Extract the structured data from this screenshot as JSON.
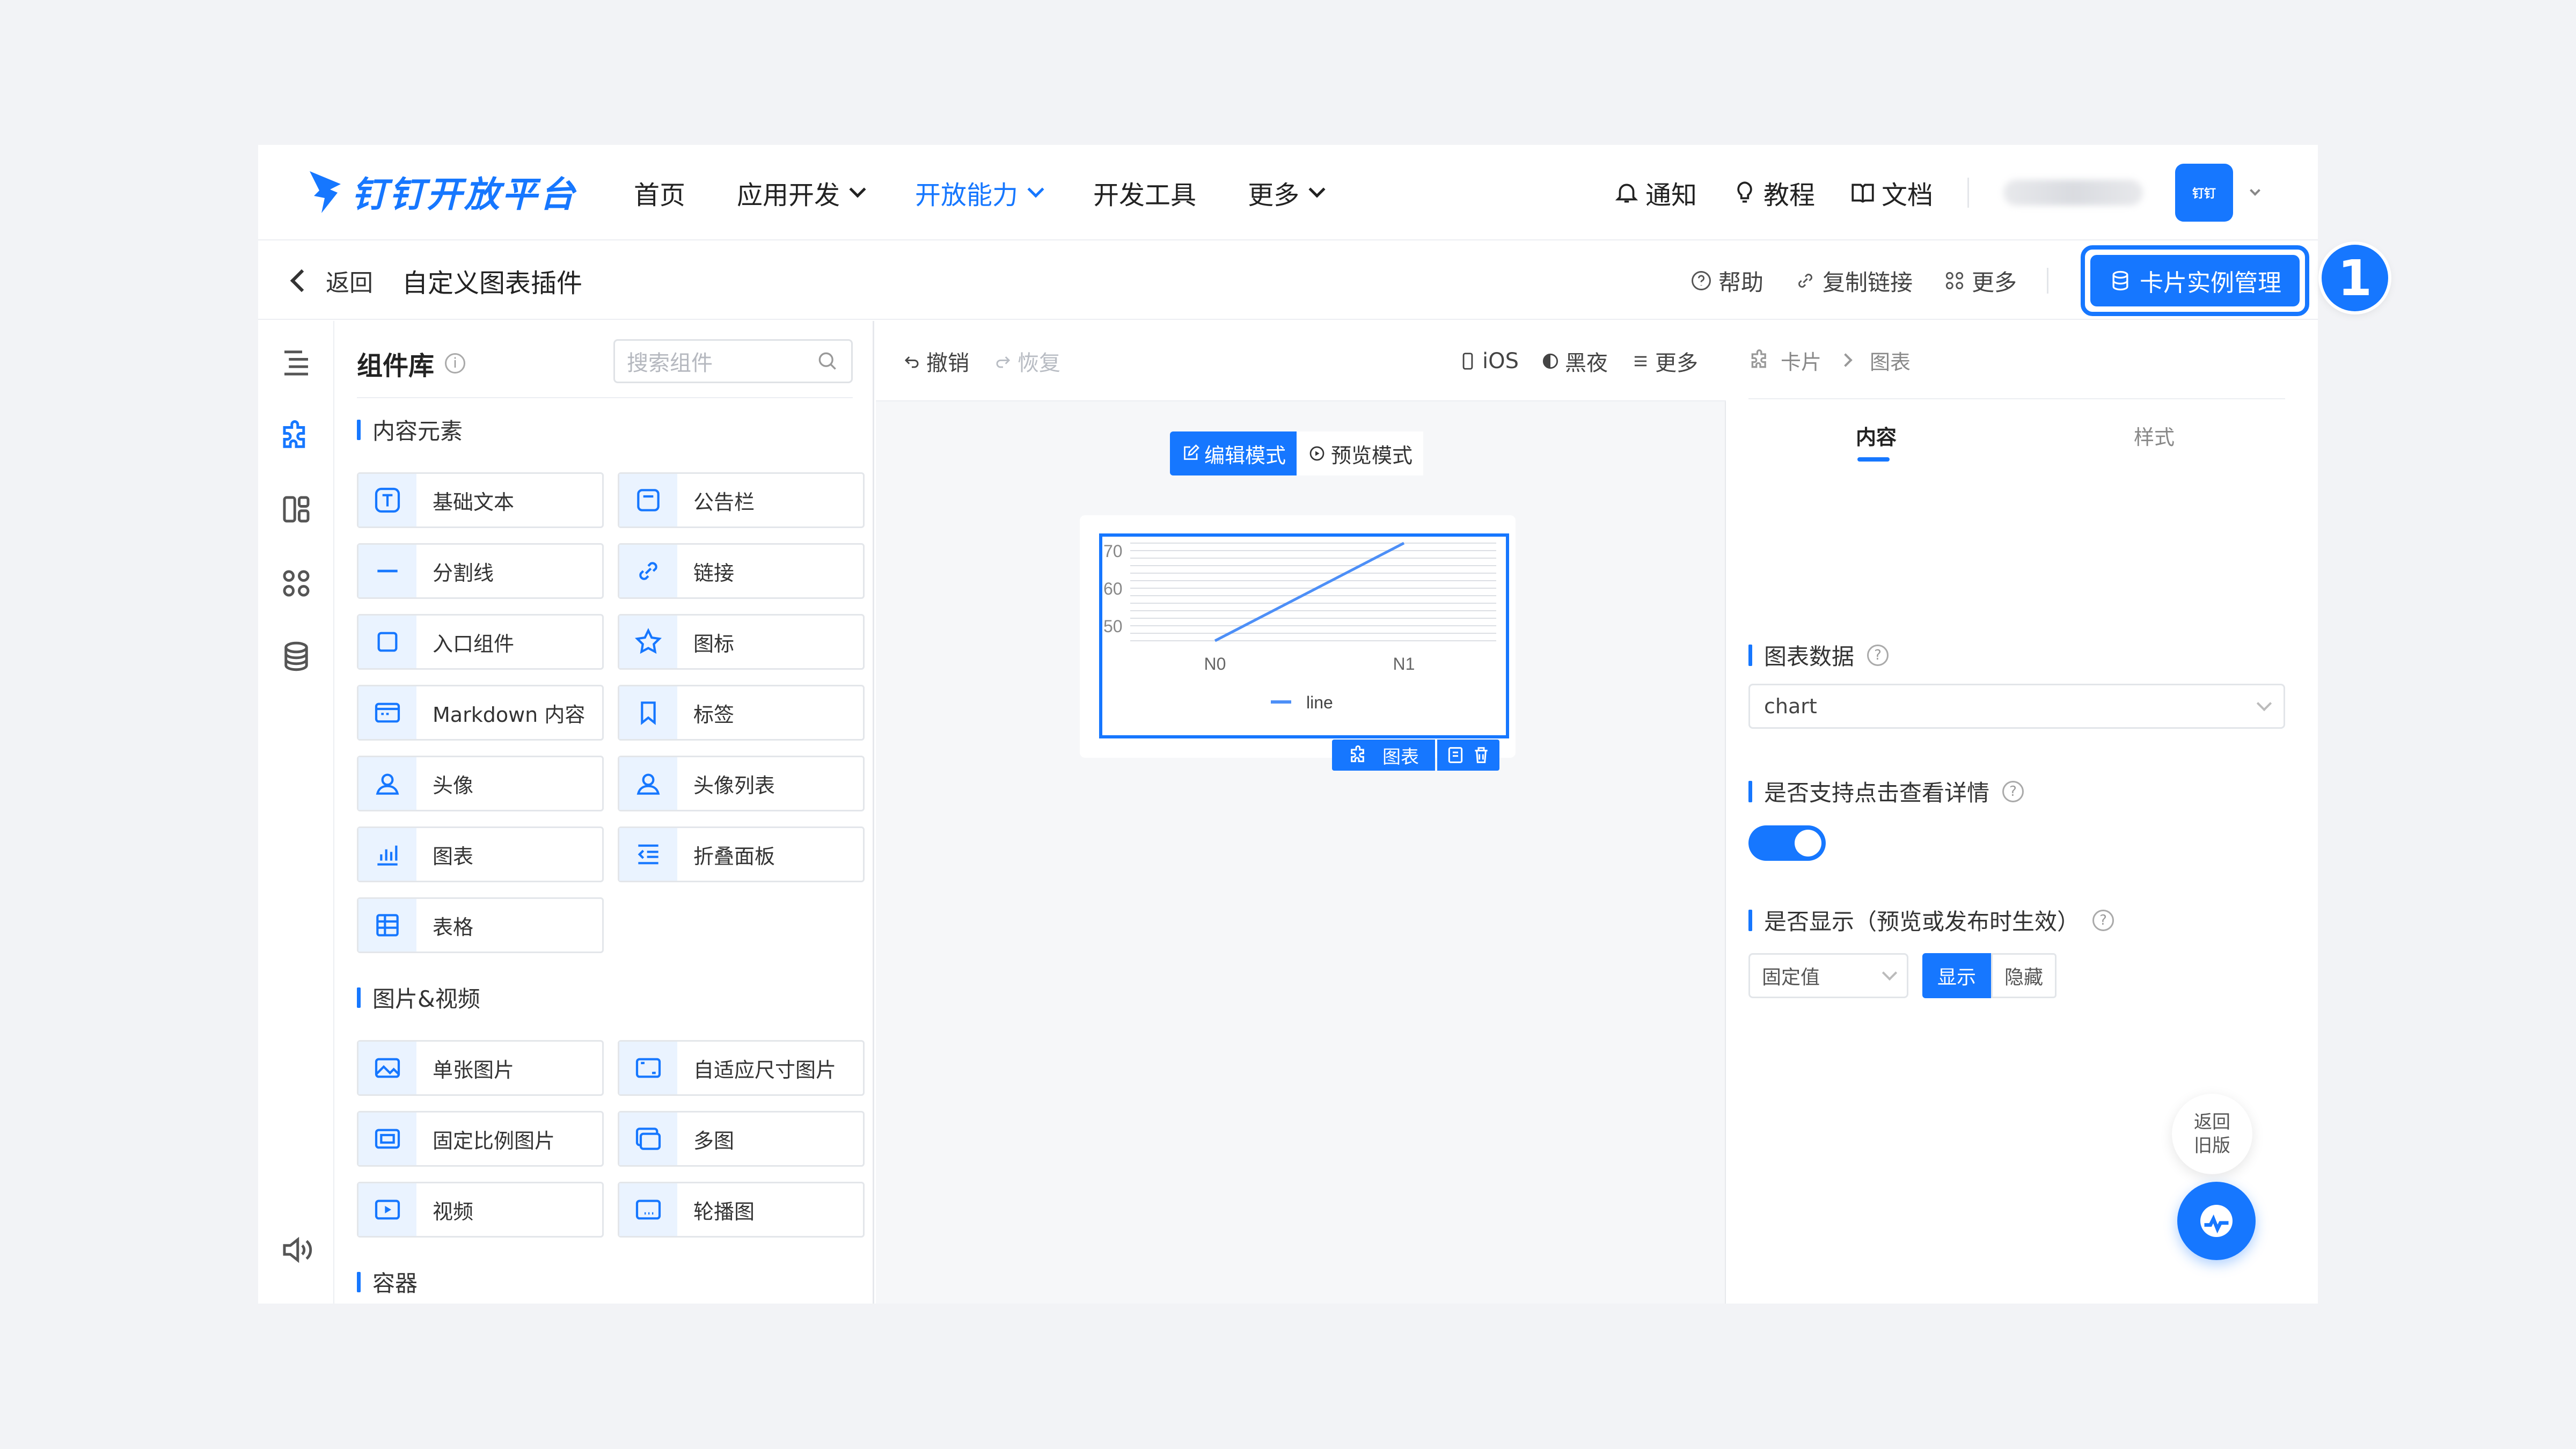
{
  "colors": {
    "accent": "#1677ff",
    "page_bg": "#f2f3f6"
  },
  "header": {
    "logo_text": "钉钉开放平台",
    "nav": [
      {
        "label": "首页"
      },
      {
        "label": "应用开发"
      },
      {
        "label": "开放能力"
      },
      {
        "label": "开发工具"
      },
      {
        "label": "更多"
      }
    ],
    "right": {
      "notify": "通知",
      "tutorial": "教程",
      "docs": "文档",
      "avatar_text": "钉钉"
    }
  },
  "subheader": {
    "back": "返回",
    "title": "自定义图表插件",
    "help": "帮助",
    "copy_link": "复制链接",
    "more": "更多",
    "card_manage": "卡片实例管理"
  },
  "library": {
    "title": "组件库",
    "search_placeholder": "搜索组件",
    "sections": {
      "content": "内容元素",
      "media": "图片&视频",
      "container": "容器"
    },
    "content_items": [
      "基础文本",
      "公告栏",
      "分割线",
      "链接",
      "入口组件",
      "图标",
      "Markdown 内容",
      "标签",
      "头像",
      "头像列表",
      "图表",
      "折叠面板",
      "表格"
    ],
    "media_items": [
      "单张图片",
      "自适应尺寸图片",
      "固定比例图片",
      "多图",
      "视频",
      "轮播图"
    ]
  },
  "canvas": {
    "undo": "撤销",
    "redo": "恢复",
    "ios": "iOS",
    "dark": "黑夜",
    "more": "更多",
    "edit_mode": "编辑模式",
    "preview_mode": "预览模式",
    "selected_label": "图表"
  },
  "chart_data": {
    "type": "line",
    "x": [
      "N0",
      "N1"
    ],
    "y_ticks": [
      50,
      60,
      70
    ],
    "ylim": [
      46,
      72
    ],
    "series": [
      {
        "name": "line",
        "values": [
          46,
          72
        ]
      }
    ],
    "legend": "bottom",
    "grid": true
  },
  "props": {
    "crumb_card": "卡片",
    "crumb_chart": "图表",
    "tab_content": "内容",
    "tab_style": "样式",
    "chart_data_label": "图表数据",
    "chart_data_value": "chart",
    "click_detail_label": "是否支持点击查看详情",
    "click_detail_on": true,
    "display_label": "是否显示（预览或发布时生效）",
    "display_mode": "固定值",
    "show": "显示",
    "hide": "隐藏",
    "back_old_1": "返回",
    "back_old_2": "旧版"
  },
  "annotation": {
    "step": "1"
  }
}
